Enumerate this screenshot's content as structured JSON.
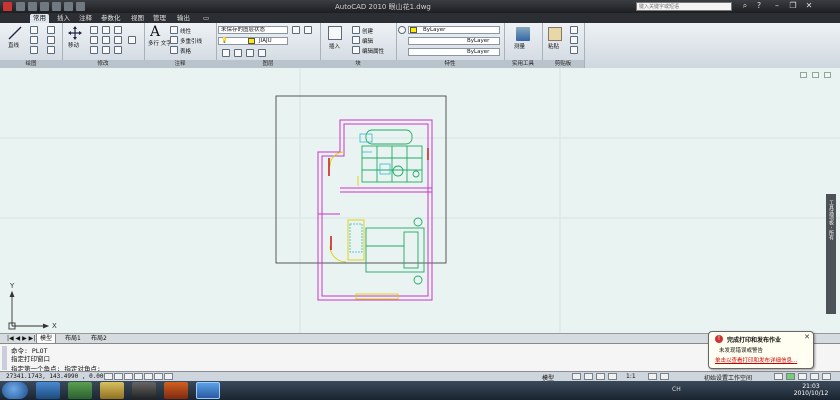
{
  "window": {
    "title": "AutoCAD 2010    眼山花1.dwg",
    "search_placeholder": "键入关键字或短语"
  },
  "ribbon_tabs": [
    "常用",
    "插入",
    "注释",
    "参数化",
    "视图",
    "管理",
    "输出"
  ],
  "ribbon": {
    "draw": {
      "title": "绘图",
      "line_label": "直线"
    },
    "modify": {
      "title": "修改",
      "move_label": "移动"
    },
    "annotation": {
      "title": "注释",
      "mtext_label": "多行\n文字",
      "linear": "线性",
      "multileader": "多重引线",
      "table": "表格"
    },
    "layers": {
      "title": "图层",
      "state": "未保存的图层状态",
      "current_layer": "JIAJU"
    },
    "block": {
      "title": "块",
      "insert_label": "插入",
      "create": "创建",
      "edit": "编辑",
      "edit_attr": "编辑属性"
    },
    "properties": {
      "title": "特性",
      "color": "ByLayer",
      "linetype": "ByLayer",
      "lineweight": "ByLayer"
    },
    "utilities": {
      "title": "实用工具",
      "measure": "测量"
    },
    "clipboard": {
      "title": "剪贴板",
      "paste": "粘贴"
    }
  },
  "layout_tabs": [
    "模型",
    "布局1",
    "布局2"
  ],
  "command": {
    "lines": [
      "命令:  PLOT",
      "指定打印窗口",
      "指定第一个角点: 指定对角点:"
    ]
  },
  "status": {
    "coords": "27341.1743, 143.4990 , 0.0000",
    "model_label": "模型",
    "scale": "1:1",
    "workspace": "初始设置工作空间"
  },
  "balloon": {
    "title": "完成打印和发布作业",
    "message": "未发现错误或警告",
    "link": "单击以查看打印和发布详细信息..."
  },
  "tool_palette": "工具选项板 - 所有",
  "ucs": {
    "x": "X",
    "y": "Y"
  },
  "taskbar": {
    "time": "21:03",
    "date": "2010/10/12",
    "tray": "CH"
  },
  "colors": {
    "canvas_bg": "#e9f3f1",
    "wall": "#cc33cc",
    "furniture": "#22aa66",
    "yellow": "#e0d000",
    "accent_red": "#cc2222",
    "cyan": "#33bbcc"
  }
}
